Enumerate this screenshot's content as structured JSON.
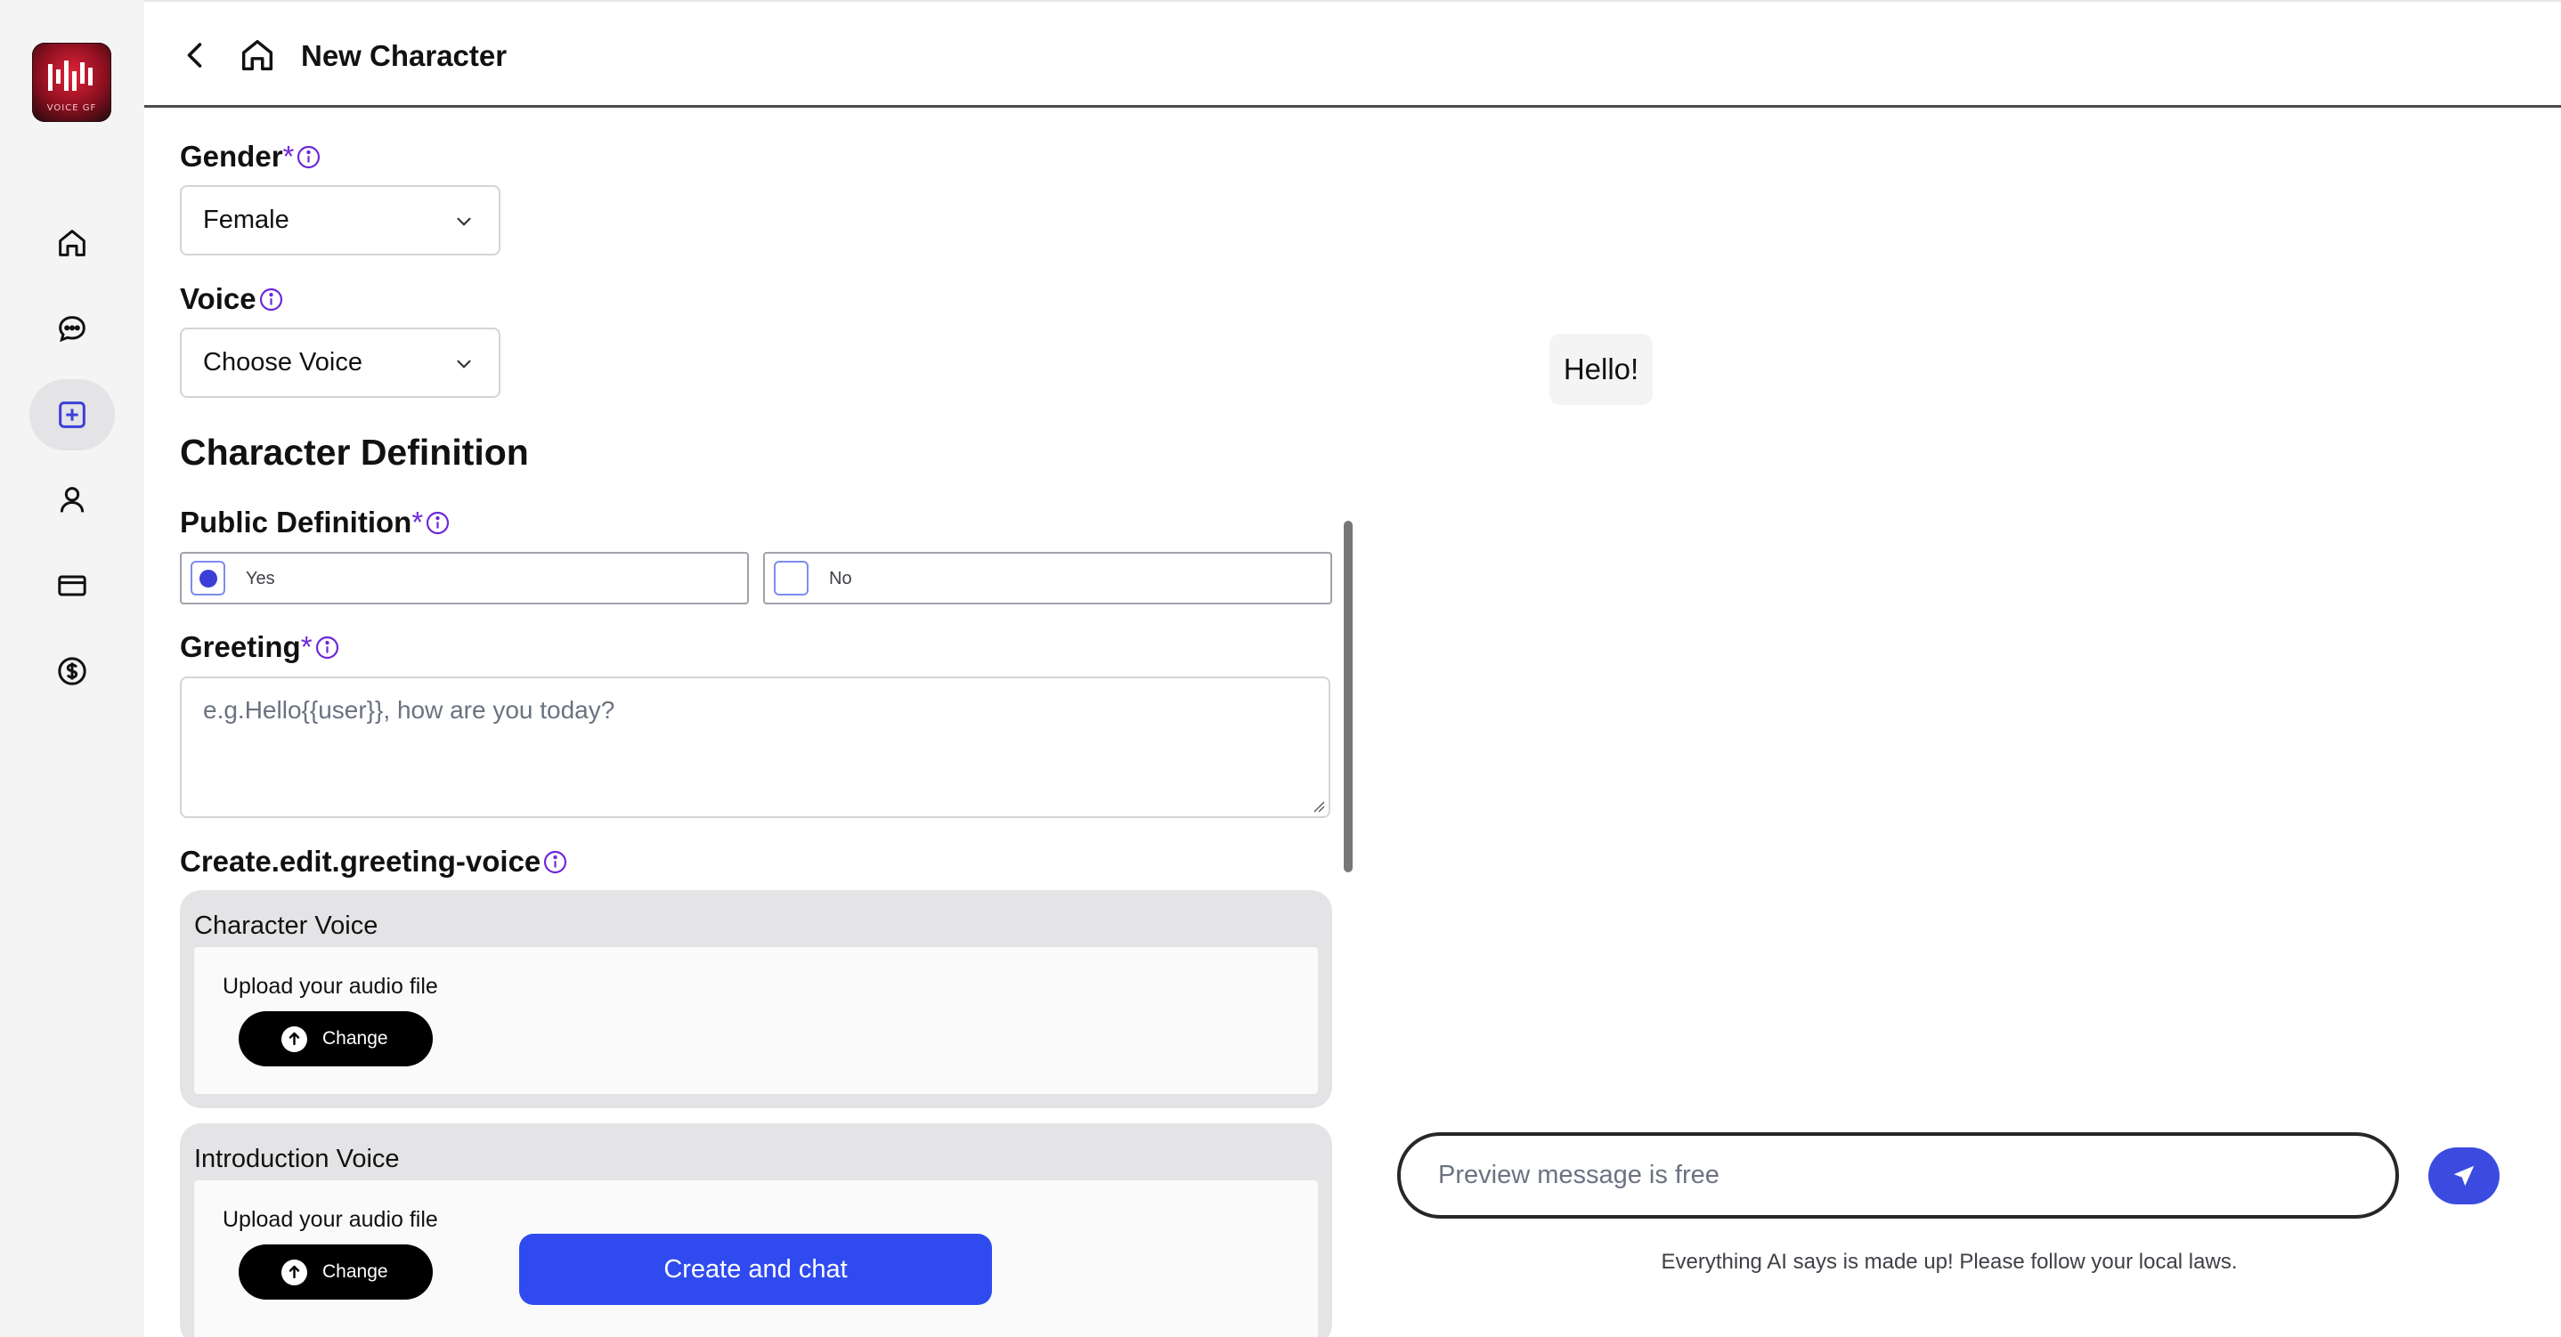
{
  "app": {
    "brand": "VOICE GF"
  },
  "header": {
    "title": "New Character"
  },
  "sidebar": {
    "items": [
      {
        "name": "home",
        "icon": "home-icon"
      },
      {
        "name": "chat",
        "icon": "chat-bubble-icon"
      },
      {
        "name": "create",
        "icon": "plus-square-icon",
        "active": true
      },
      {
        "name": "profile",
        "icon": "user-icon"
      },
      {
        "name": "billing",
        "icon": "credit-card-icon"
      },
      {
        "name": "pricing",
        "icon": "dollar-circle-icon"
      }
    ]
  },
  "form": {
    "gender": {
      "label": "Gender",
      "required": "*",
      "value": "Female"
    },
    "voice": {
      "label": "Voice",
      "value": "Choose Voice"
    },
    "definition_title": "Character Definition",
    "public_definition": {
      "label": "Public Definition",
      "required": "*",
      "options": [
        {
          "label": "Yes",
          "checked": true
        },
        {
          "label": "No",
          "checked": false
        }
      ]
    },
    "greeting": {
      "label": "Greeting",
      "required": "*",
      "placeholder": "e.g.Hello{{user}}, how are you today?"
    },
    "greeting_voice": {
      "label": "Create.edit.greeting-voice",
      "cards": [
        {
          "title": "Character Voice",
          "upload_label": "Upload your audio file",
          "button": "Change"
        },
        {
          "title": "Introduction Voice",
          "upload_label": "Upload your audio file",
          "button": "Change"
        }
      ]
    },
    "submit_label": "Create and chat"
  },
  "preview": {
    "greeting_bubble": "Hello!",
    "input_placeholder": "Preview message is free",
    "disclaimer": "Everything AI says is made up! Please follow your local laws."
  },
  "colors": {
    "accent": "#2f4bf0",
    "required": "#6d28d9",
    "send": "#3b4be0"
  }
}
